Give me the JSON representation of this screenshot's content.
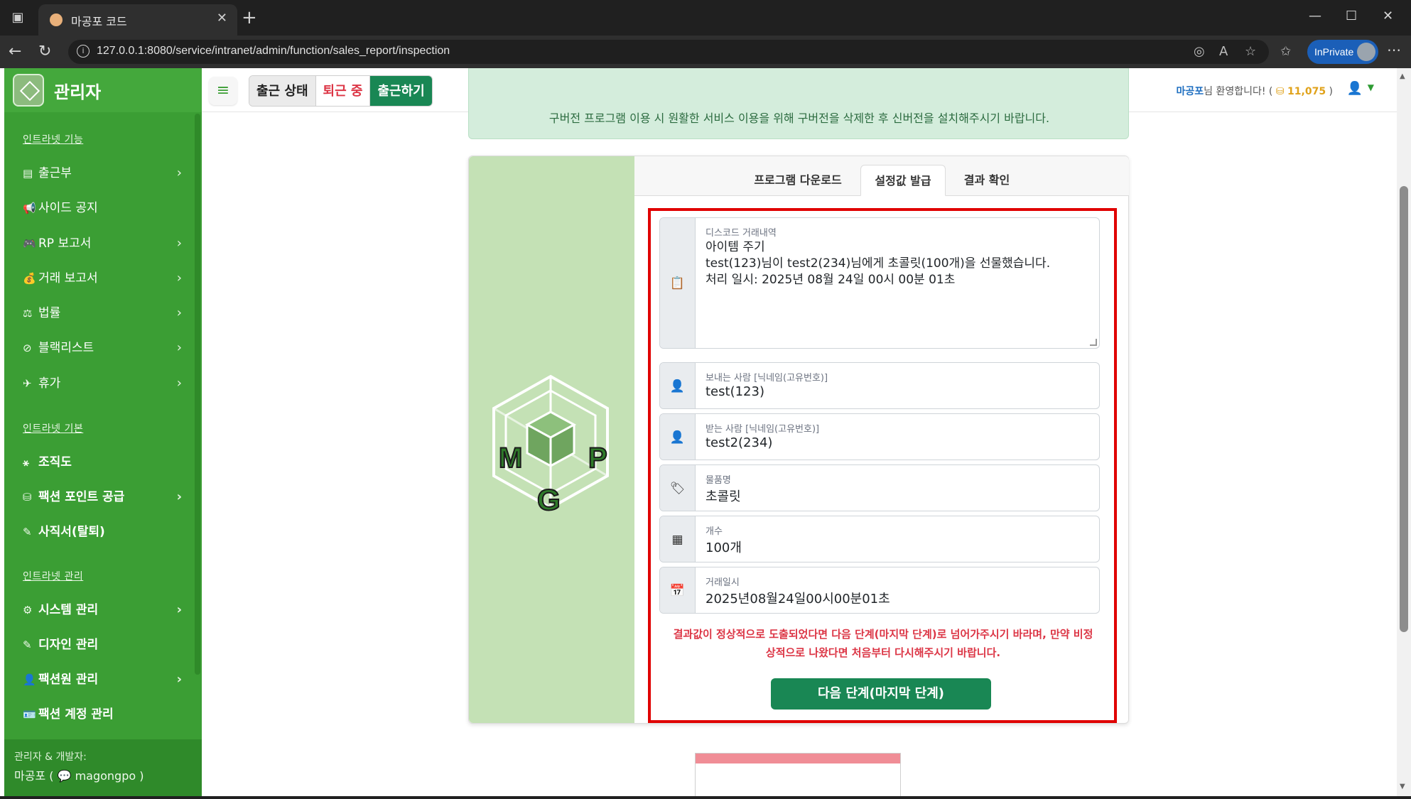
{
  "browser": {
    "tab_title": "마공포 코드",
    "tab_close": "✕",
    "new_tab": "+",
    "url": "127.0.0.1:8080/service/intranet/admin/function/sales_report/inspection",
    "inprivate_label": "InPrivate",
    "window_controls": [
      "—",
      "☐",
      "✕"
    ]
  },
  "sidebar": {
    "title": "관리자",
    "sections": [
      {
        "heading": "인트라넷 기능",
        "items": [
          {
            "label": "출근부",
            "icon": "book-icon",
            "glyph": "▤",
            "has_chevron": true
          },
          {
            "label": "사이드 공지",
            "icon": "megaphone-icon",
            "glyph": "📢",
            "has_chevron": false
          },
          {
            "label": "RP 보고서",
            "icon": "gamepad-icon",
            "glyph": "🎮",
            "has_chevron": true
          },
          {
            "label": "거래 보고서",
            "icon": "money-bag-icon",
            "glyph": "💰",
            "has_chevron": true
          },
          {
            "label": "법률",
            "icon": "scale-icon",
            "glyph": "⚖",
            "has_chevron": true
          },
          {
            "label": "블랙리스트",
            "icon": "ban-icon",
            "glyph": "⊘",
            "has_chevron": true
          },
          {
            "label": "휴가",
            "icon": "plane-icon",
            "glyph": "✈",
            "has_chevron": true
          }
        ]
      },
      {
        "heading": "인트라넷 기본",
        "items": [
          {
            "label": "조직도",
            "icon": "sitemap-icon",
            "glyph": "⚹",
            "has_chevron": false
          },
          {
            "label": "팩션 포인트 공급",
            "icon": "coins-icon",
            "glyph": "⛁",
            "has_chevron": true
          },
          {
            "label": "사직서(탈퇴)",
            "icon": "pen-icon",
            "glyph": "✎",
            "has_chevron": false
          }
        ]
      },
      {
        "heading": "인트라넷 관리",
        "items": [
          {
            "label": "시스템 관리",
            "icon": "gear-icon",
            "glyph": "⚙",
            "has_chevron": true
          },
          {
            "label": "디자인 관리",
            "icon": "brush-icon",
            "glyph": "✎",
            "has_chevron": false
          },
          {
            "label": "팩션원 관리",
            "icon": "user-gear-icon",
            "glyph": "👤",
            "has_chevron": true
          },
          {
            "label": "팩션 계정 관리",
            "icon": "id-card-icon",
            "glyph": "🪪",
            "has_chevron": false
          }
        ]
      }
    ],
    "footer_line1": "관리자 & 개발자:",
    "footer_line2": "마공포 ( 💬 magongpo )"
  },
  "header": {
    "status_label": "출근 상태",
    "status_value": "퇴근 중",
    "checkin_button": "출근하기",
    "welcome_name": "마공포",
    "welcome_text": "님 환영합니다! (",
    "coin_amount": "11,075",
    "welcome_close": ")"
  },
  "notice_text": "구버전 프로그램 이용 시 원활한 서비스 이용을 위해 구버전을 삭제한 후 신버전을 설치해주시기 바랍니다.",
  "tabs": [
    {
      "label": "프로그램 다운로드",
      "active": false
    },
    {
      "label": "설정값 발급",
      "active": true
    },
    {
      "label": "결과 확인",
      "active": false
    }
  ],
  "logo_letters": [
    "M",
    "G",
    "P"
  ],
  "form": {
    "discord_log": {
      "label": "디스코드 거래내역",
      "lines": [
        "아이템 주기",
        "test(123)님이 test2(234)님에게 초콜릿(100개)을 선물했습니다.",
        "처리 일시: 2025년 08월 24일 00시 00분 01초"
      ],
      "icon": "clipboard-icon"
    },
    "sender": {
      "label": "보내는 사람 [닉네임(고유번호)]",
      "value": "test(123)",
      "icon": "user-icon"
    },
    "receiver": {
      "label": "받는 사람 [닉네임(고유번호)]",
      "value": "test2(234)",
      "icon": "user-icon"
    },
    "item": {
      "label": "물품명",
      "value": "초콜릿",
      "icon": "tag-icon"
    },
    "count": {
      "label": "개수",
      "value": "100개",
      "icon": "boxes-icon"
    },
    "datetime": {
      "label": "거래일시",
      "value": "2025년08월24일00시00분01초",
      "icon": "calendar-icon"
    }
  },
  "warning_line1": "결과값이 정상적으로 도출되었다면 다음 단계(마지막 단계)로 넘어가주시기 바라며, 만약 비정",
  "warning_line2": "상적으로 나왔다면 처음부터 다시해주시기 바랍니다.",
  "next_button": "다음 단계(마지막 단계)",
  "colors": {
    "sidebar": "#3b9e34",
    "primary_button": "#198754",
    "danger": "#dc3545",
    "highlight_border": "#e00000"
  }
}
